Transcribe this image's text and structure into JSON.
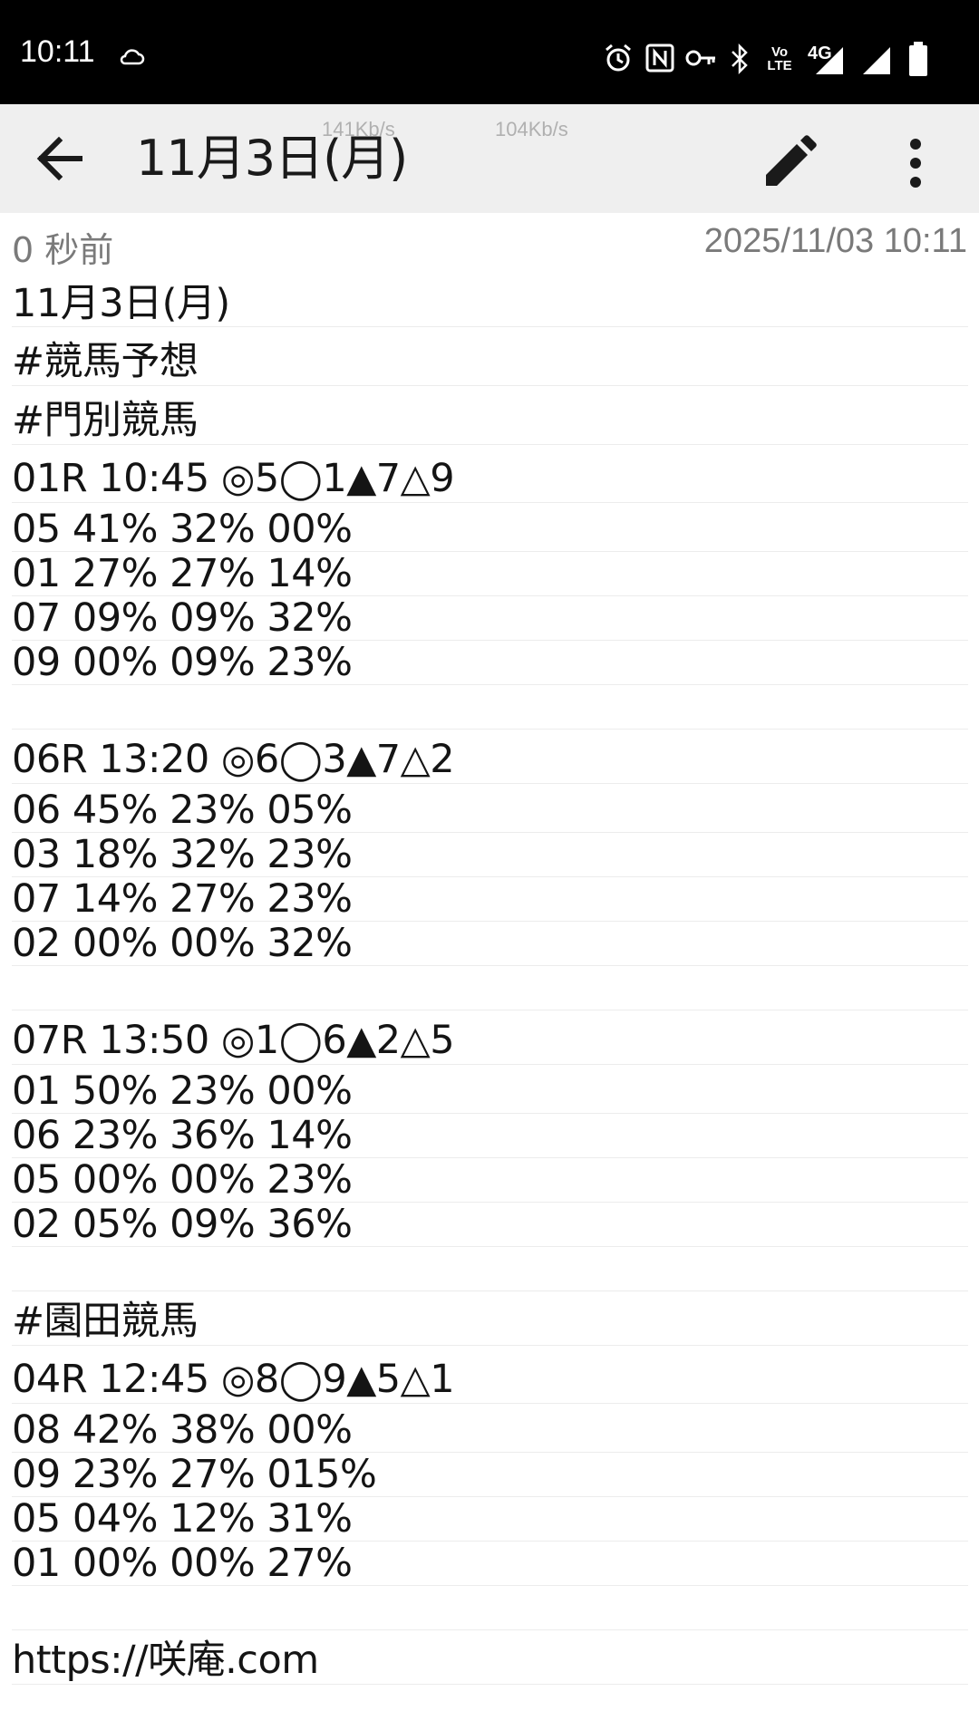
{
  "status_bar": {
    "time": "10:11",
    "icons": [
      "cloud-icon",
      "alarm-icon",
      "nfc-icon",
      "vpn-key-icon",
      "bluetooth-icon",
      "volte-icon",
      "signal-4g-icon",
      "signal-icon",
      "battery-icon"
    ],
    "network_label": "4G",
    "volte_label_top": "Vo",
    "volte_label_bottom": "LTE"
  },
  "app_bar": {
    "title": "11月3日(月)",
    "speed_left": "141Kb/s",
    "speed_right": "104Kb/s"
  },
  "meta": {
    "relative_time": "0 秒前",
    "timestamp": "2025/11/03 10:11"
  },
  "note": {
    "lines": [
      "11月3日(月)",
      "#競馬予想",
      "#門別競馬",
      "01R 10:45 ◎5◯1▲7△9",
      "05 41% 32% 00%",
      "01 27% 27% 14%",
      "07 09% 09% 32%",
      "09 00% 09% 23%",
      "",
      "06R 13:20 ◎6◯3▲7△2",
      "06 45% 23% 05%",
      "03 18% 32% 23%",
      "07 14% 27% 23%",
      "02 00% 00% 32%",
      "",
      "07R 13:50 ◎1◯6▲2△5",
      "01 50% 23% 00%",
      "06 23% 36% 14%",
      "05 00% 00% 23%",
      "02 05% 09% 36%",
      "",
      "#園田競馬",
      "04R 12:45 ◎8◯9▲5△1",
      "08 42% 38% 00%",
      "09 23% 27% 015%",
      "05 04% 12% 31%",
      "01 00% 00% 27%",
      "",
      "https://咲庵.com"
    ]
  }
}
